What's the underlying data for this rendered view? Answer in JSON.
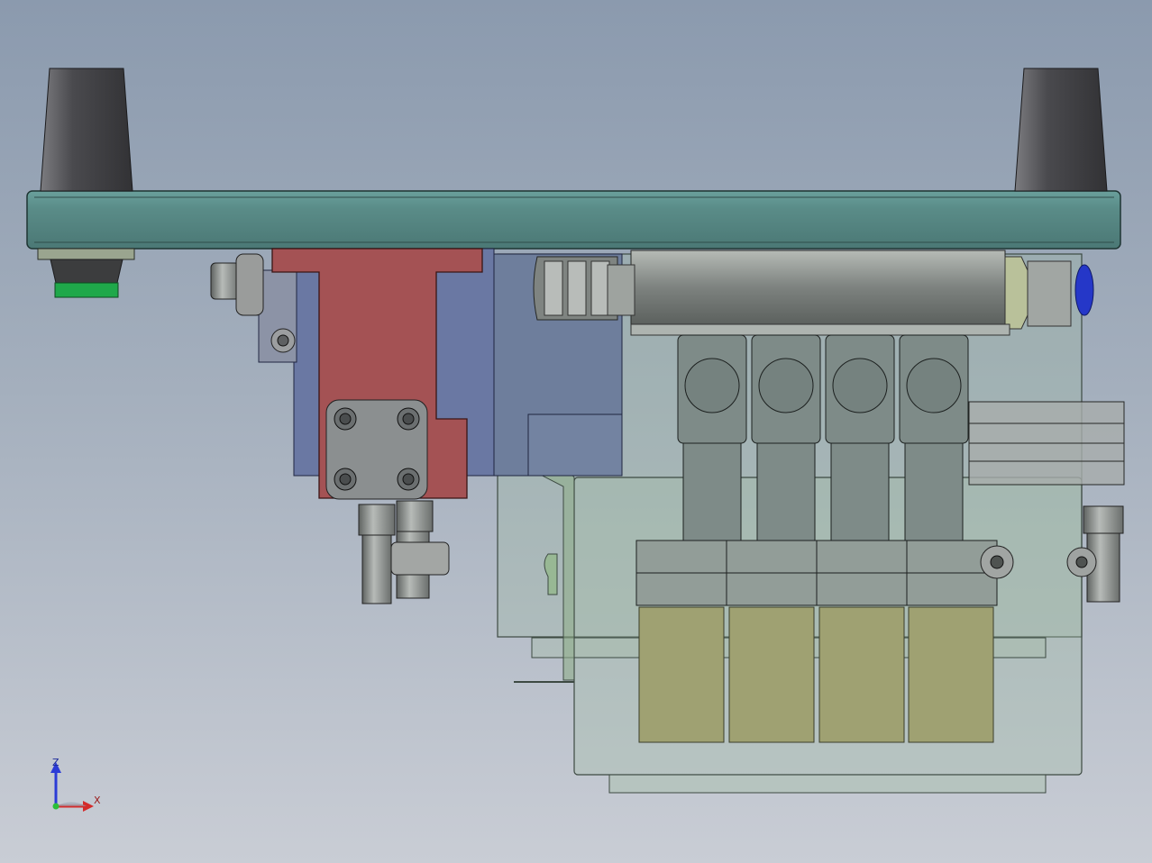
{
  "view": {
    "title": "",
    "triad": {
      "z_label": "Z",
      "x_label": "X",
      "colors": {
        "z": "#2b3bd6",
        "x": "#d42a2a",
        "y": "#2bbf3a"
      }
    }
  },
  "palette": {
    "plate": "#5a8c88",
    "red_block": "#a45254",
    "blue_block": "#6a78a3",
    "valve_body": "#8b938f",
    "coil": "#7e8b88",
    "yellow_pad": "#9fa172",
    "enclosure": "#93ab9a",
    "cone": "#4a4a4c",
    "green_ring": "#1fa84a",
    "blue_fitting": "#2537c8"
  },
  "components": {
    "valve_count": 4,
    "pad_count": 4
  }
}
